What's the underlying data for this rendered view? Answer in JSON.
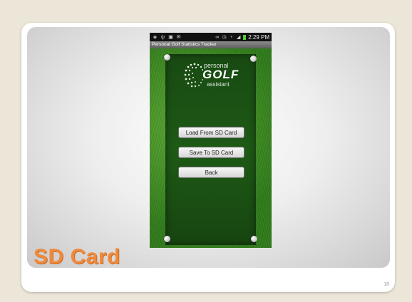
{
  "slide": {
    "title": "SD Card",
    "page_number": "18"
  },
  "phone": {
    "status_bar": {
      "time": "2:29 PM",
      "left_icons": [
        "shield-icon",
        "usb-icon",
        "image-icon",
        "mail-icon"
      ],
      "right_icons": [
        "voicemail-icon",
        "alarm-icon",
        "wifi-icon",
        "signal-icon",
        "battery-icon"
      ]
    },
    "app_title": "Personal Golf Statistics Tracker",
    "logo": {
      "line1": "personal",
      "line2": "GOLF",
      "line3": "assistant"
    },
    "buttons": [
      {
        "label": "Load From SD Card"
      },
      {
        "label": "Save To SD Card"
      },
      {
        "label": "Back"
      }
    ]
  },
  "colors": {
    "title_accent": "#ef8a3c",
    "grass": "#3d8a22",
    "board": "#1e5a16",
    "battery": "#4fd12d"
  }
}
